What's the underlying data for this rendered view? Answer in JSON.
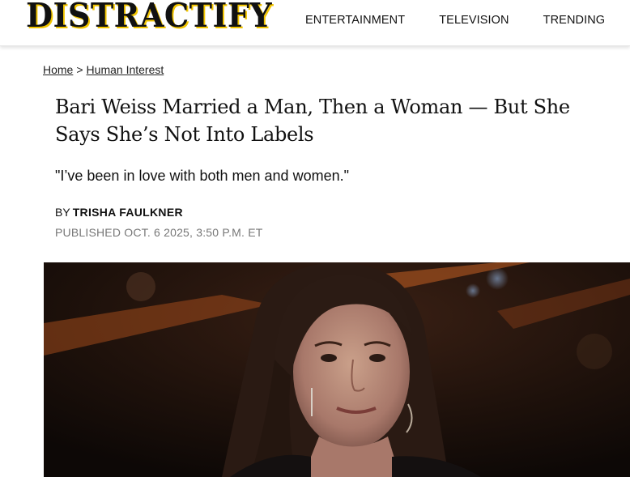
{
  "site": {
    "logo_text": "DISTRACTIFY",
    "brand_accent": "#f2c500"
  },
  "nav": {
    "items": [
      {
        "label": "ENTERTAINMENT"
      },
      {
        "label": "TELEVISION"
      },
      {
        "label": "TRENDING"
      }
    ]
  },
  "breadcrumb": {
    "home": "Home",
    "separator": ">",
    "category": "Human Interest"
  },
  "article": {
    "headline": "Bari Weiss Married a Man, Then a Woman — But She Says She’s Not Into Labels",
    "dek": "\"I’ve been in love with both men and women.\"",
    "byline_prefix": "BY",
    "author": "TRISHA FAULKNER",
    "published": "PUBLISHED OCT. 6 2025, 3:50 P.M. ET"
  },
  "hero_image": {
    "subject": "woman-portrait-photo"
  }
}
